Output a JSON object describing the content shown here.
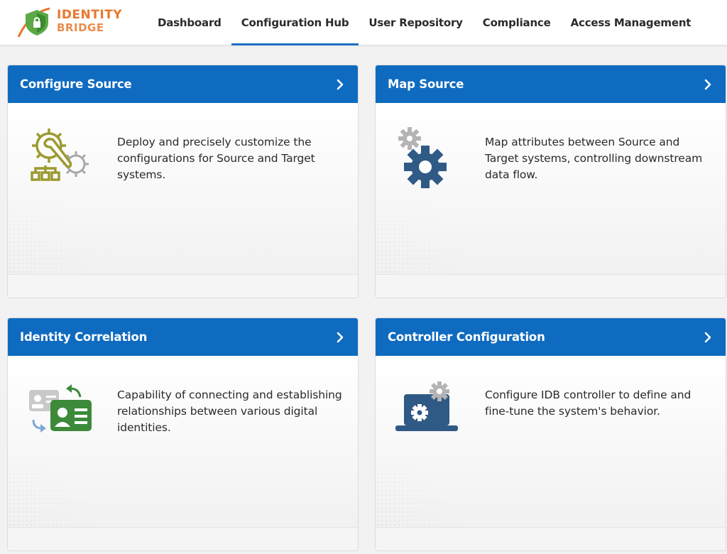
{
  "brand": {
    "line1": "IDENTITY",
    "line2": "BRIDGE"
  },
  "nav": [
    {
      "label": "Dashboard",
      "active": false
    },
    {
      "label": "Configuration Hub",
      "active": true
    },
    {
      "label": "User Repository",
      "active": false
    },
    {
      "label": "Compliance",
      "active": false
    },
    {
      "label": "Access Management",
      "active": false
    }
  ],
  "cards": [
    {
      "title": "Configure Source",
      "icon": "gear-wrench-hierarchy-icon",
      "description": "Deploy and precisely customize the configurations for Source and Target systems."
    },
    {
      "title": "Map Source",
      "icon": "gears-icon",
      "description": "Map attributes between Source and Target systems, controlling downstream data flow."
    },
    {
      "title": "Identity Correlation",
      "icon": "id-cards-icon",
      "description": "Capability of connecting and establishing relationships between various digital identities."
    },
    {
      "title": "Controller Configuration",
      "icon": "laptop-gears-icon",
      "description": "Configure IDB controller to define and fine-tune the system's behavior."
    }
  ],
  "colors": {
    "header_blue": "#0f6bc0",
    "brand_orange": "#e8772e",
    "active_underline": "#1e6fc0"
  }
}
